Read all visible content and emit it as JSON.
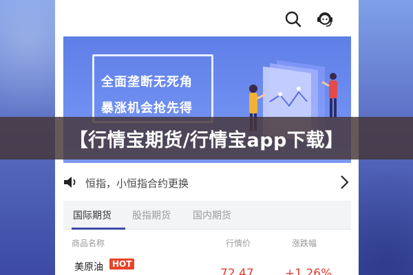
{
  "overlay": {
    "title": "【行情宝期货/行情宝app下载】"
  },
  "header": {
    "icons": [
      "search-icon",
      "customer-service-icon"
    ]
  },
  "banner": {
    "line1": "全面垄断无死角",
    "line2": "暴涨机会抢先得"
  },
  "notice": {
    "text": "恒指，小恒指合约更换",
    "icons": [
      "speaker-icon",
      "chevron-right-icon"
    ]
  },
  "tabs": [
    {
      "label": "国际期货",
      "active": true
    },
    {
      "label": "股指期货",
      "active": false
    },
    {
      "label": "国内期货",
      "active": false
    }
  ],
  "table": {
    "headers": [
      "商品名称",
      "行情价",
      "涨跌幅"
    ],
    "rows": [
      {
        "name": "美原油",
        "badge": "HOT",
        "price": "72.47",
        "change": "+1.26%"
      }
    ]
  },
  "colors": {
    "accent": "#3c4aa3",
    "banner_bg": "#6d8cf0",
    "overlay_bg": "#463436",
    "up_red": "#e23a2e",
    "badge_red": "#e8442a"
  }
}
